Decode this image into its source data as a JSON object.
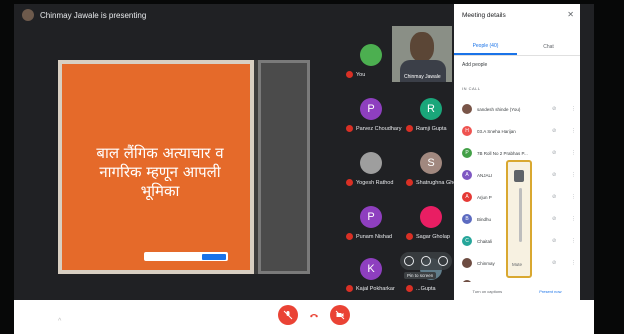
{
  "presentation": {
    "banner": "Chinmay Jawale is presenting",
    "slide_lines": [
      "बाल लैंगिक अत्याचार व",
      "नागरिक म्हणून आपली",
      "भूमिका"
    ]
  },
  "tiles": [
    {
      "id": "you",
      "label": "You",
      "avatar": "",
      "color": "#4caf50"
    },
    {
      "id": "chinmay",
      "label": "Chinmay Jawale",
      "avatar": "",
      "color": "#5b4636"
    },
    {
      "id": "parvez",
      "label": "Parvez Choudhary",
      "avatar": "P",
      "color": "#8e3fbf"
    },
    {
      "id": "ramji",
      "label": "Ramji Gupta",
      "avatar": "R",
      "color": "#1aa67a"
    },
    {
      "id": "yogesh",
      "label": "Yogesh Rathod",
      "avatar": "",
      "color": "#9e9e9e"
    },
    {
      "id": "shatrughna",
      "label": "Shatrughna Gho...",
      "avatar": "S",
      "color": "#a1887f"
    },
    {
      "id": "punam",
      "label": "Punam Nishad",
      "avatar": "P",
      "color": "#8e3fbf"
    },
    {
      "id": "sagar",
      "label": "Sagar Gholap",
      "avatar": "",
      "color": "#e91e63"
    },
    {
      "id": "kajal",
      "label": "Kajal Pokharkar",
      "avatar": "K",
      "color": "#8e3fbf"
    },
    {
      "id": "unknown",
      "label": "...Gupta",
      "avatar": "",
      "color": "#607d8b"
    }
  ],
  "details": {
    "title": "Meeting details",
    "tab_people": "People (40)",
    "tab_chat": "Chat",
    "add_people": "Add people",
    "in_call": "IN CALL",
    "participants": [
      {
        "name": "sandesh shinde (You)",
        "initial": "",
        "color": "#795548"
      },
      {
        "name": "03.A Sneha Harijan",
        "initial": "H",
        "color": "#ef5350"
      },
      {
        "name": "7B Roll No 2 Prabhas P...",
        "initial": "P",
        "color": "#43a047"
      },
      {
        "name": "ANJALI",
        "initial": "A",
        "color": "#7e57c2"
      },
      {
        "name": "Arjun P",
        "initial": "A",
        "color": "#e53935"
      },
      {
        "name": "Bindhu",
        "initial": "B",
        "color": "#5c6bc0"
      },
      {
        "name": "Chaitali",
        "initial": "C",
        "color": "#26a69a"
      },
      {
        "name": "Chinmay",
        "initial": "",
        "color": "#6d4c41"
      },
      {
        "name": "Chinmay",
        "initial": "",
        "color": "#6d4c41"
      }
    ],
    "volume_label": "Mute",
    "bottom_left": "Turn on captions",
    "bottom_mid": "Present now"
  },
  "tooltip": "Pin to screen",
  "watermark": "POCO",
  "colors": {
    "accent": "#1a73e8",
    "danger": "#ea4335",
    "slide": "#e56a2a"
  }
}
